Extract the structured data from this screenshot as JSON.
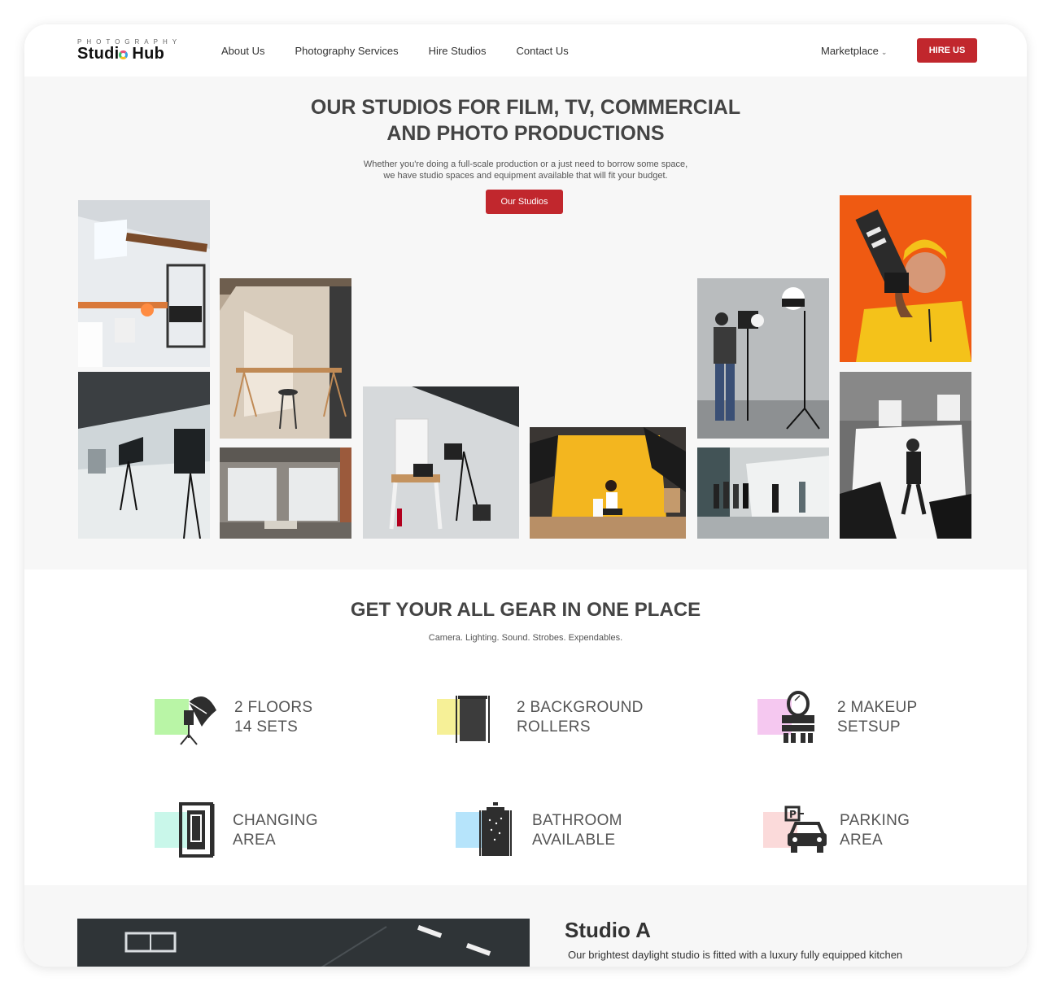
{
  "header": {
    "logo_small": "PHOTOGRAPHY",
    "logo_big_a": "Studi",
    "logo_big_b": "Hub",
    "nav": [
      "About Us",
      "Photography Services",
      "Hire Studios",
      "Contact Us"
    ],
    "marketplace": "Marketplace",
    "hire_label": "HIRE US"
  },
  "hero": {
    "title_line1": "OUR STUDIOS FOR FILM, TV, COMMERCIAL",
    "title_line2": "AND PHOTO PRODUCTIONS",
    "sub_line1": "Whether you're doing a full-scale production or a just need to borrow some space,",
    "sub_line2": "we have studio spaces and equipment available that will fit your budget.",
    "button": "Our Studios"
  },
  "gear": {
    "title": "GET YOUR ALL GEAR IN ONE PLACE",
    "subtitle": "Camera. Lighting. Sound. Strobes. Expendables.",
    "features": [
      {
        "line1": "2 FLOORS",
        "line2": "14 SETS",
        "icon": "umbrella-light-icon",
        "color": "#b9f5a6"
      },
      {
        "line1": "2 BACKGROUND",
        "line2": "ROLLERS",
        "icon": "background-roller-icon",
        "color": "#f6f097"
      },
      {
        "line1": "2 MAKEUP",
        "line2": "SETSUP",
        "icon": "makeup-mirror-icon",
        "color": "#f5c8f0"
      },
      {
        "line1": "CHANGING",
        "line2": "AREA",
        "icon": "changing-room-icon",
        "color": "#c9f7ea"
      },
      {
        "line1": "BATHROOM",
        "line2": "AVAILABLE",
        "icon": "shower-icon",
        "color": "#b6e4fb"
      },
      {
        "line1": "PARKING",
        "line2": "AREA",
        "icon": "parking-car-icon",
        "color": "#fbdada"
      }
    ]
  },
  "studio_a": {
    "title": "Studio A",
    "desc": "Our brightest daylight studio is fitted with a luxury fully equipped kitchen"
  },
  "colors": {
    "accent": "#c1272d",
    "heading": "#444444",
    "hero_bg": "#f7f7f7"
  }
}
